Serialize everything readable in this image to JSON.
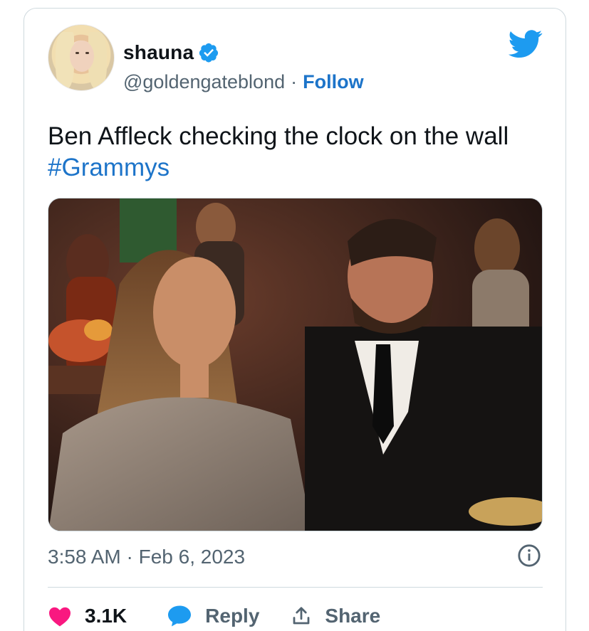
{
  "author": {
    "display_name": "shauna",
    "handle": "@goldengateblond",
    "separator": "·",
    "follow_label": "Follow"
  },
  "tweet": {
    "text": "Ben Affleck checking the clock on the wall",
    "hashtag": "#Grammys",
    "timestamp": "3:58 AM · Feb 6, 2023"
  },
  "actions": {
    "like_count": "3.1K",
    "reply_label": "Reply",
    "share_label": "Share"
  },
  "colors": {
    "accent": "#1d9bf0",
    "like": "#f91880",
    "text_secondary": "#536471"
  },
  "icons": [
    "verified-badge-icon",
    "twitter-bird-icon",
    "info-icon",
    "heart-icon",
    "reply-bubble-icon",
    "share-icon"
  ]
}
